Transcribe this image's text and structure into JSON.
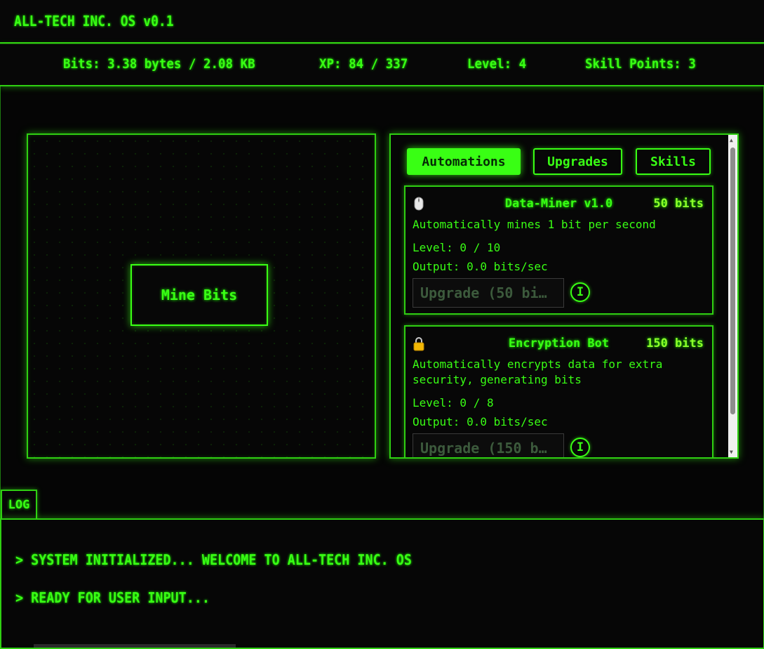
{
  "header": {
    "title": "ALL-TECH INC. OS v0.1"
  },
  "stats": {
    "bits": "Bits: 3.38 bytes / 2.08 KB",
    "xp": "XP: 84 / 337",
    "level": "Level: 4",
    "skill_points": "Skill Points: 3"
  },
  "mine": {
    "button_label": "Mine Bits"
  },
  "shop": {
    "tabs": [
      {
        "label": "Automations",
        "active": true
      },
      {
        "label": "Upgrades",
        "active": false
      },
      {
        "label": "Skills",
        "active": false
      }
    ],
    "items": [
      {
        "icon": "mouse-icon",
        "name": "Data-Miner v1.0",
        "cost": "50 bits",
        "description": "Automatically mines 1 bit per second",
        "level": "Level: 0 / 10",
        "output": "Output: 0.0 bits/sec",
        "upgrade_label": "Upgrade (50 bi…",
        "info_label": "I"
      },
      {
        "icon": "lock-icon",
        "name": "Encryption Bot",
        "cost": "150 bits",
        "description": "Automatically encrypts data for extra security, generating bits",
        "level": "Level: 0 / 8",
        "output": "Output: 0.0 bits/sec",
        "upgrade_label": "Upgrade (150 b…",
        "info_label": "I"
      }
    ]
  },
  "log": {
    "tab_label": "LOG",
    "lines": [
      "> SYSTEM INITIALIZED... WELCOME TO ALL-TECH INC. OS",
      "> READY FOR USER INPUT..."
    ]
  },
  "colors": {
    "accent": "#39ff14",
    "background": "#050505",
    "cost": "#8dff2a"
  }
}
